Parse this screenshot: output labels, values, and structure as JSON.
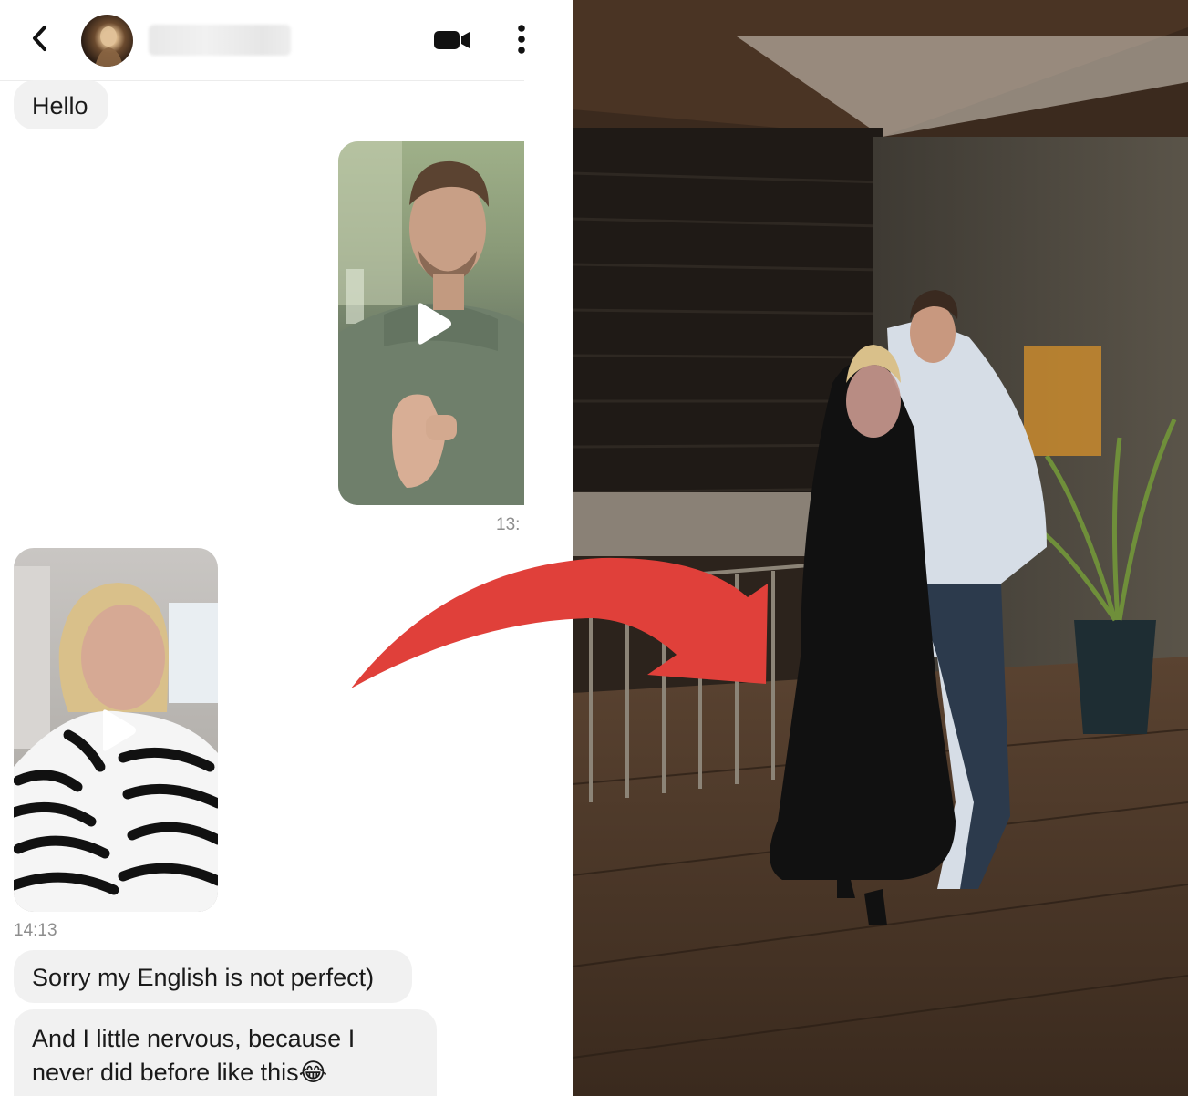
{
  "chat": {
    "header": {
      "back_icon": "chevron-left-icon",
      "video_call_icon": "video-camera-icon",
      "menu_icon": "more-vertical-icon"
    },
    "messages": [
      {
        "from": "them",
        "type": "text",
        "text": "Hello"
      },
      {
        "from": "me",
        "type": "video",
        "timestamp": "13:"
      },
      {
        "from": "them",
        "type": "video",
        "timestamp": "14:13"
      },
      {
        "from": "them",
        "type": "text",
        "text": "Sorry my English is not perfect)"
      },
      {
        "from": "them",
        "type": "text",
        "text": "And I little nervous, because I never did before like this😂"
      }
    ]
  },
  "colors": {
    "bubble_bg": "#f1f1f1",
    "timestamp": "#8d8d8d",
    "arrow": "#e0403a"
  }
}
